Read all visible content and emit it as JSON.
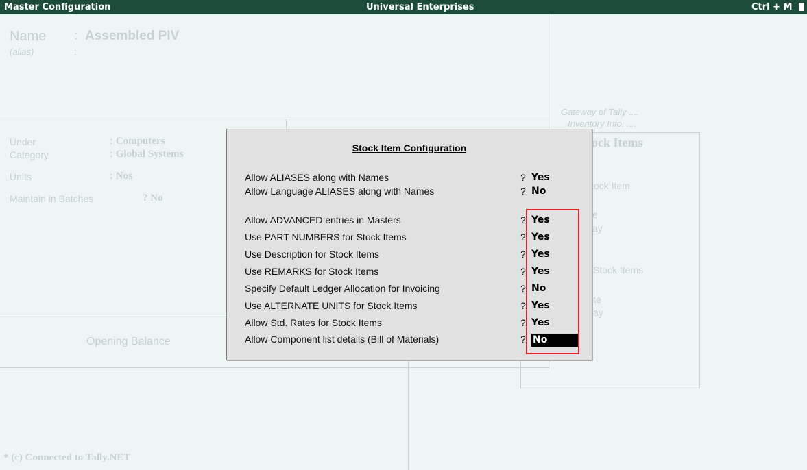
{
  "titlebar": {
    "left": "Master Configuration",
    "center": "Universal Enterprises",
    "right": "Ctrl + M"
  },
  "form": {
    "name_label": "Name",
    "name_colon": ":",
    "name_value": "Assembled PIV",
    "alias_label": "(alias)",
    "alias_colon": ":",
    "under_label": "Under",
    "under_value": ": Computers",
    "category_label": "Category",
    "category_value": ": Global Systems",
    "units_label": "Units",
    "units_value": ": Nos",
    "batches_label": "Maintain in Batches",
    "batches_value": "? No",
    "opening_balance": "Opening Balance",
    "footer": "* (c) Connected to Tally.NET"
  },
  "gateway": {
    "line1": "Gateway of Tally ....",
    "line2": "Inventory Info. ....",
    "panel_title": "ock Items",
    "item1": "tock Item",
    "frag1": "e",
    "frag2": "ay",
    "item2": "Stock Items",
    "frag3": "te",
    "frag4": "ay"
  },
  "dialog": {
    "title": "Stock Item Configuration",
    "options": [
      {
        "label": "Allow ALIASES along with Names",
        "q": "?",
        "value": "Yes"
      },
      {
        "label": "Allow Language ALIASES along with Names",
        "q": "?",
        "value": "No"
      },
      {
        "label": "Allow ADVANCED entries in Masters",
        "q": "?",
        "value": "Yes"
      },
      {
        "label": "Use PART NUMBERS for Stock Items",
        "q": "?",
        "value": "Yes"
      },
      {
        "label": "Use Description for Stock Items",
        "q": "?",
        "value": "Yes"
      },
      {
        "label": "Use REMARKS for Stock Items",
        "q": "?",
        "value": "Yes"
      },
      {
        "label": "Specify Default Ledger Allocation for Invoicing",
        "q": "?",
        "value": "No"
      },
      {
        "label": "Use ALTERNATE UNITS for Stock Items",
        "q": "?",
        "value": "Yes"
      },
      {
        "label": "Allow Std. Rates for Stock Items",
        "q": "?",
        "value": "Yes"
      },
      {
        "label": "Allow Component list details (Bill of Materials)",
        "q": "?",
        "value": "No"
      }
    ]
  },
  "colors": {
    "titlebar_bg": "#1d4d3a",
    "highlight_box": "#e5242a",
    "selected_bg": "#000000"
  }
}
